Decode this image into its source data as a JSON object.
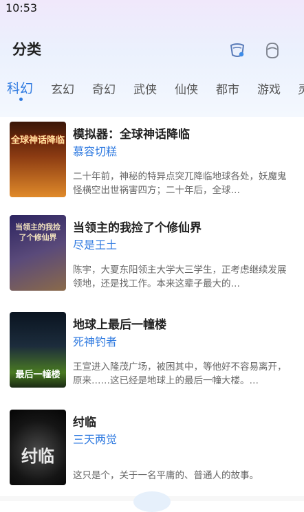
{
  "status": {
    "time": "10:53"
  },
  "header": {
    "title": "分类",
    "icons": [
      "cup-icon",
      "face-icon"
    ]
  },
  "tabs": [
    {
      "label": "科幻",
      "active": true
    },
    {
      "label": "玄幻"
    },
    {
      "label": "奇幻"
    },
    {
      "label": "武侠"
    },
    {
      "label": "仙侠"
    },
    {
      "label": "都市"
    },
    {
      "label": "游戏"
    },
    {
      "label": "灵"
    }
  ],
  "books": [
    {
      "title": "模拟器：全球神话降临",
      "author": "慕容切糕",
      "desc": "二十年前，神秘的特异点突兀降临地球各处，妖魔鬼怪横空出世祸害四方；二十年后，全球…",
      "cover_text": "全球神话降临",
      "cover_colors": [
        "#7a2b10",
        "#d9772a"
      ]
    },
    {
      "title": "当领主的我捡了个修仙界",
      "author": "尽是王土",
      "desc": "陈宇，大夏东阳领主大学大三学生，正考虑继续发展领地，还是找工作。本来这辈子最大的…",
      "cover_text": "当领主的我捡了个修仙界",
      "cover_colors": [
        "#3a2a6a",
        "#7a5a3a"
      ]
    },
    {
      "title": "地球上最后一幢楼",
      "author": "死神钓者",
      "desc": "王宣进入隆茂广场，被困其中，等他好不容易离开，原来……这已经是地球上的最后一幢大楼。…",
      "cover_text": "最后一幢楼",
      "cover_colors": [
        "#0d1a2a",
        "#3a6a20"
      ]
    },
    {
      "title": "纣临",
      "author": "三天两觉",
      "desc": "这只是个，关于一名平庸的、普通人的故事。",
      "cover_text": "纣临",
      "cover_colors": [
        "#0a0a0a",
        "#3a3a3a"
      ]
    }
  ]
}
